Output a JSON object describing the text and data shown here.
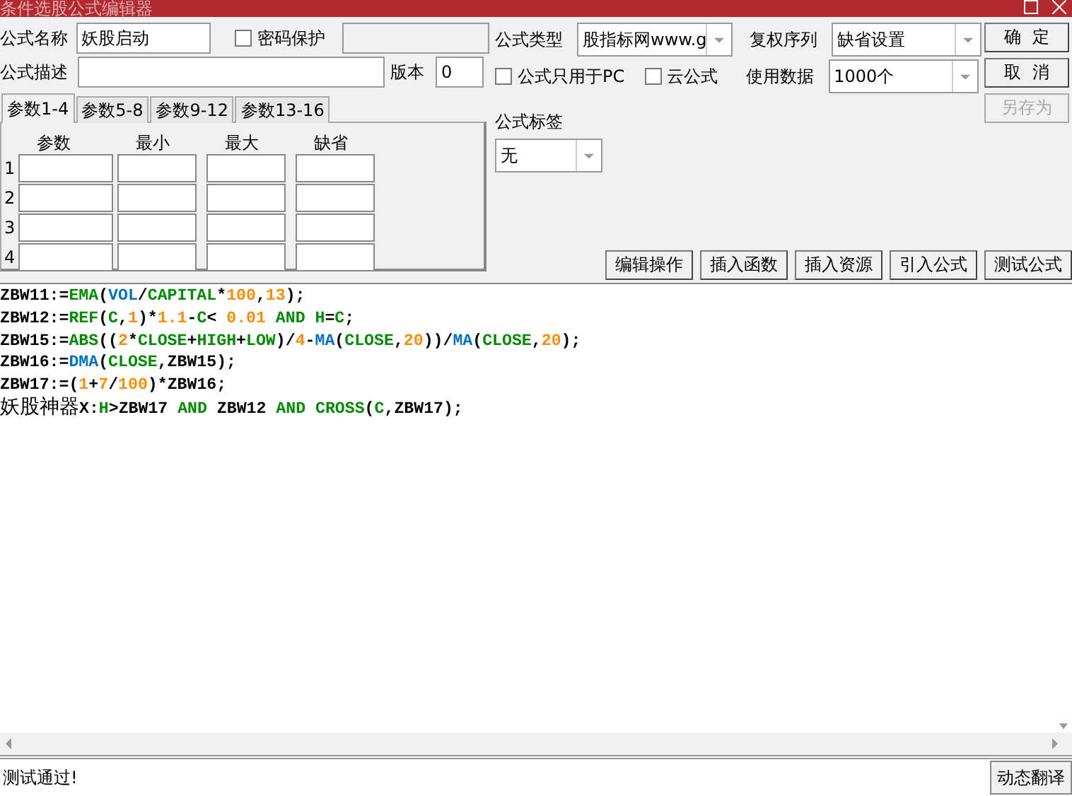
{
  "window": {
    "title": "条件选股公式编辑器"
  },
  "name_field": {
    "label": "公式名称",
    "value": "妖股启动"
  },
  "password": {
    "label": "密码保护",
    "checked": false,
    "field_disabled": true
  },
  "description_field": {
    "label": "公式描述"
  },
  "version_field": {
    "label": "版本",
    "value": "0"
  },
  "param_tabs": [
    {
      "label": "参数1-4",
      "selected": true
    },
    {
      "label": "参数5-8",
      "selected": false
    },
    {
      "label": "参数9-12",
      "selected": false
    },
    {
      "label": "参数13-16",
      "selected": false
    }
  ],
  "param_table": {
    "columns": [
      "参数",
      "最小",
      "最大",
      "缺省"
    ],
    "rows": [
      "1",
      "2",
      "3",
      "4"
    ]
  },
  "formula_type": {
    "label": "公式类型",
    "value": "股指标网www.g"
  },
  "adjust_order": {
    "label": "复权序列",
    "value": "缺省设置"
  },
  "options": [
    {
      "label": "公式只用于PC",
      "checked": false
    },
    {
      "label": "云公式",
      "checked": false
    }
  ],
  "data_count": {
    "label": "使用数据",
    "value": "1000个"
  },
  "formula_tag": {
    "label": "公式标签",
    "value": "无"
  },
  "side_buttons": [
    {
      "label": "确  定",
      "disabled": false
    },
    {
      "label": "取  消",
      "disabled": false
    },
    {
      "label": "另存为",
      "disabled": true
    }
  ],
  "tool_buttons": [
    "编辑操作",
    "插入函数",
    "插入资源",
    "引入公式",
    "测试公式"
  ],
  "code_lines": [
    [
      {
        "kind": "text",
        "text": "ZBW11:="
      },
      {
        "kind": "func",
        "text": "EMA"
      },
      {
        "kind": "text",
        "text": "("
      },
      {
        "kind": "var",
        "text": "VOL"
      },
      {
        "kind": "text",
        "text": "/"
      },
      {
        "kind": "func",
        "text": "CAPITAL"
      },
      {
        "kind": "text",
        "text": "*"
      },
      {
        "kind": "num",
        "text": "100"
      },
      {
        "kind": "text",
        "text": ","
      },
      {
        "kind": "num",
        "text": "13"
      },
      {
        "kind": "text",
        "text": ");"
      }
    ],
    [
      {
        "kind": "text",
        "text": "ZBW12:="
      },
      {
        "kind": "func",
        "text": "REF"
      },
      {
        "kind": "text",
        "text": "("
      },
      {
        "kind": "func",
        "text": "C"
      },
      {
        "kind": "text",
        "text": ","
      },
      {
        "kind": "num",
        "text": "1"
      },
      {
        "kind": "text",
        "text": ")*"
      },
      {
        "kind": "num",
        "text": "1.1"
      },
      {
        "kind": "text",
        "text": "-"
      },
      {
        "kind": "func",
        "text": "C"
      },
      {
        "kind": "text",
        "text": "< "
      },
      {
        "kind": "num",
        "text": "0.01"
      },
      {
        "kind": "func",
        "text": " AND H"
      },
      {
        "kind": "text",
        "text": "="
      },
      {
        "kind": "func",
        "text": "C"
      },
      {
        "kind": "text",
        "text": ";"
      }
    ],
    [
      {
        "kind": "text",
        "text": "ZBW15:="
      },
      {
        "kind": "func",
        "text": "ABS"
      },
      {
        "kind": "text",
        "text": "(("
      },
      {
        "kind": "num",
        "text": "2"
      },
      {
        "kind": "text",
        "text": "*"
      },
      {
        "kind": "func",
        "text": "CLOSE"
      },
      {
        "kind": "text",
        "text": "+"
      },
      {
        "kind": "func",
        "text": "HIGH"
      },
      {
        "kind": "text",
        "text": "+"
      },
      {
        "kind": "func",
        "text": "LOW"
      },
      {
        "kind": "text",
        "text": ")/"
      },
      {
        "kind": "num",
        "text": "4"
      },
      {
        "kind": "text",
        "text": "-"
      },
      {
        "kind": "var",
        "text": "MA"
      },
      {
        "kind": "text",
        "text": "("
      },
      {
        "kind": "func",
        "text": "CLOSE"
      },
      {
        "kind": "text",
        "text": ","
      },
      {
        "kind": "num",
        "text": "20"
      },
      {
        "kind": "text",
        "text": "))/"
      },
      {
        "kind": "var",
        "text": "MA"
      },
      {
        "kind": "text",
        "text": "("
      },
      {
        "kind": "func",
        "text": "CLOSE"
      },
      {
        "kind": "text",
        "text": ","
      },
      {
        "kind": "num",
        "text": "20"
      },
      {
        "kind": "text",
        "text": ");"
      }
    ],
    [
      {
        "kind": "text",
        "text": "ZBW16:="
      },
      {
        "kind": "var",
        "text": "DMA"
      },
      {
        "kind": "text",
        "text": "("
      },
      {
        "kind": "func",
        "text": "CLOSE"
      },
      {
        "kind": "text",
        "text": ",ZBW15);"
      }
    ],
    [
      {
        "kind": "text",
        "text": "ZBW17:=("
      },
      {
        "kind": "num",
        "text": "1"
      },
      {
        "kind": "text",
        "text": "+"
      },
      {
        "kind": "num",
        "text": "7"
      },
      {
        "kind": "text",
        "text": "/"
      },
      {
        "kind": "num",
        "text": "100"
      },
      {
        "kind": "text",
        "text": ")*ZBW16;"
      }
    ],
    [
      {
        "kind": "cjk",
        "text": "妖股神器"
      },
      {
        "kind": "text",
        "text": "X:"
      },
      {
        "kind": "func",
        "text": "H"
      },
      {
        "kind": "text",
        "text": ">ZBW17 "
      },
      {
        "kind": "func",
        "text": "AND"
      },
      {
        "kind": "text",
        "text": " ZBW12 "
      },
      {
        "kind": "func",
        "text": "AND CROSS"
      },
      {
        "kind": "text",
        "text": "("
      },
      {
        "kind": "func",
        "text": "C"
      },
      {
        "kind": "text",
        "text": ",ZBW17);"
      }
    ]
  ],
  "status_bar": {
    "message": "测试通过!",
    "button": "动态翻译"
  }
}
